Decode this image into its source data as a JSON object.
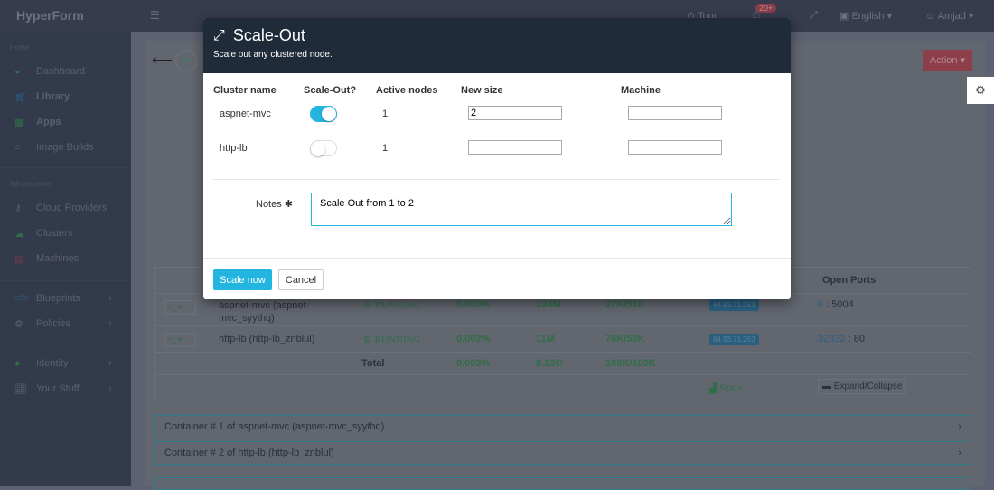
{
  "app": {
    "brand": "HyperForm"
  },
  "topbar": {
    "tour": "Tour",
    "notifications": "20+",
    "language": "English",
    "user": "Amjad"
  },
  "sidebar": {
    "sections": [
      "Home",
      "Infrastructure"
    ],
    "items": [
      {
        "label": "Dashboard",
        "icon": "dashboard-icon"
      },
      {
        "label": "Library",
        "icon": "cart-icon"
      },
      {
        "label": "Apps",
        "icon": "grid-icon"
      },
      {
        "label": "Image Builds",
        "icon": "circle-icon"
      },
      {
        "label": "Cloud Providers",
        "icon": "key-icon"
      },
      {
        "label": "Clusters",
        "icon": "cloud-icon"
      },
      {
        "label": "Machines",
        "icon": "server-icon"
      },
      {
        "label": "Blueprints",
        "icon": "code-icon"
      },
      {
        "label": "Policies",
        "icon": "gear-icon"
      },
      {
        "label": "Identity",
        "icon": "user-icon"
      },
      {
        "label": "Your Stuff",
        "icon": "chart-icon"
      }
    ]
  },
  "page": {
    "action_label": "Action",
    "table": {
      "open_ports_header": "Open Ports",
      "rows": [
        {
          "name": "aspnet-mvc (aspnet-mvc_syythq)",
          "status": "RUNNING",
          "cpu": "0.000%",
          "mem": "124M",
          "net": "27K/51K",
          "ip": "64.93.71.253",
          "port_link": "0",
          "port": ": 5004"
        },
        {
          "name": "http-lb (http-lb_znblul)",
          "status": "RUNNING",
          "cpu": "0.002%",
          "mem": "11M",
          "net": "76K/58K",
          "ip": "64.93.71.253",
          "port_link": "32832",
          "port": ": 80"
        }
      ],
      "total": {
        "label": "Total",
        "cpu": "0.003%",
        "mem": "0.13G",
        "net": "103K/109K"
      },
      "stats_label": "Stats",
      "expand_label": "Expand/Collapse"
    },
    "accordions": [
      "Container # 1 of aspnet-mvc (aspnet-mvc_syythq)",
      "Container # 2 of http-lb (http-lb_znblul)"
    ]
  },
  "modal": {
    "title": "Scale-Out",
    "subtitle": "Scale out any clustered node.",
    "headers": [
      "Cluster name",
      "Scale-Out?",
      "Active nodes",
      "New size",
      "Machine"
    ],
    "rows": [
      {
        "cluster": "aspnet-mvc",
        "scale_out": true,
        "active": "1",
        "new_size": "2",
        "machine": ""
      },
      {
        "cluster": "http-lb",
        "scale_out": false,
        "active": "1",
        "new_size": "",
        "machine": ""
      }
    ],
    "notes_label": "Notes ✱",
    "notes_value": "Scale Out from 1 to 2",
    "scale_button": "Scale now",
    "cancel_button": "Cancel"
  }
}
